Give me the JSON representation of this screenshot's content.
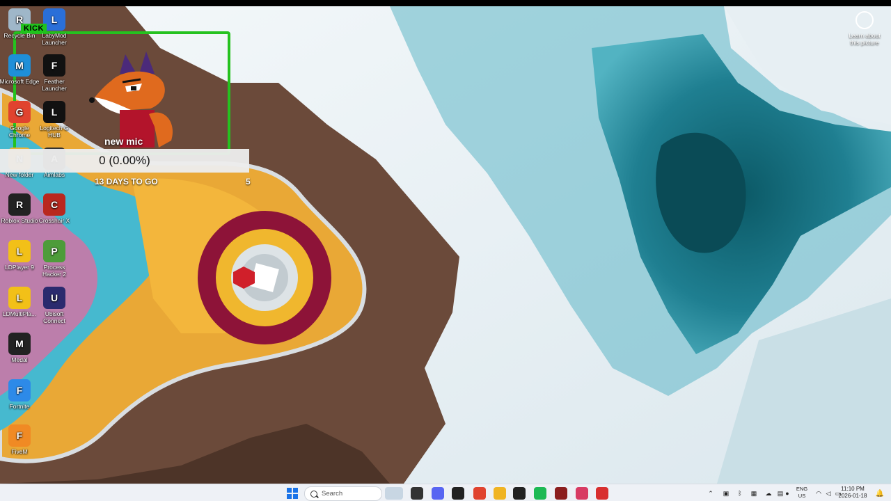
{
  "colors": {
    "ice": "#eaf2f5",
    "water": "#2b8ea0",
    "deep_water": "#0c5e6c",
    "rock": "#6b4a3a",
    "overlay_green": "#25c21f",
    "taskbar_bg": "#eef1f6"
  },
  "desktop_icons": [
    {
      "label": "Recycle Bin",
      "icon": "recycle-bin-icon",
      "color": "#9fb7c9"
    },
    {
      "label": "LabyMod Launcher",
      "icon": "labymod-icon",
      "color": "#2a6fd8"
    },
    {
      "label": "Microsoft Edge",
      "icon": "edge-icon",
      "color": "#1f8fd8"
    },
    {
      "label": "Feather Launcher",
      "icon": "feather-icon",
      "color": "#111111"
    },
    {
      "label": "Google Chrome",
      "icon": "chrome-icon",
      "color": "#e0432f"
    },
    {
      "label": "Logitech G HUB",
      "icon": "logitech-icon",
      "color": "#111111"
    },
    {
      "label": "New folder",
      "icon": "folder-icon",
      "color": "#e9b43a"
    },
    {
      "label": "Aimlabs",
      "icon": "aimlabs-icon",
      "color": "#333333"
    },
    {
      "label": "Roblox Studio",
      "icon": "roblox-icon",
      "color": "#222222"
    },
    {
      "label": "Crosshair X",
      "icon": "crosshair-icon",
      "color": "#b9281f"
    },
    {
      "label": "LDPlayer 9",
      "icon": "ldplayer-icon",
      "color": "#f2c018"
    },
    {
      "label": "Process Hacker 2",
      "icon": "process-hacker-icon",
      "color": "#4d9c3a"
    },
    {
      "label": "LDMultiPla...",
      "icon": "ldmultiplayer-icon",
      "color": "#f2c018"
    },
    {
      "label": "Ubisoft Connect",
      "icon": "ubisoft-icon",
      "color": "#2a2a6e"
    },
    {
      "label": "Medal",
      "icon": "medal-icon",
      "color": "#222222"
    },
    {
      "label": "Fortnite",
      "icon": "fortnite-icon",
      "color": "#2d8ae8"
    },
    {
      "label": "FiveM",
      "icon": "fivem-icon",
      "color": "#f08a24"
    }
  ],
  "overlay": {
    "badge": "KICK",
    "stream_title": "new mic",
    "goal_text": "0 (0.00%)",
    "countdown": "13 DAYS TO GO",
    "marker": "5"
  },
  "learn_about": {
    "label": "Learn about this picture",
    "icon": "camera-info-icon"
  },
  "taskbar": {
    "start_icon": "windows-start-icon",
    "search_placeholder": "Search",
    "pinned": [
      {
        "name": "widgets-icon",
        "color": "#c8d6e3"
      },
      {
        "name": "file-explorer-icon",
        "color": "#333333"
      },
      {
        "name": "discord-icon",
        "color": "#5865f2"
      },
      {
        "name": "epic-games-icon",
        "color": "#222222"
      },
      {
        "name": "chrome-icon",
        "color": "#e0432f"
      },
      {
        "name": "chrome-canary-icon",
        "color": "#f0b423"
      },
      {
        "name": "github-icon",
        "color": "#222222"
      },
      {
        "name": "spotify-icon",
        "color": "#1db954"
      },
      {
        "name": "medal-icon",
        "color": "#8b1e1e"
      },
      {
        "name": "snipping-tool-icon",
        "color": "#d83b63"
      },
      {
        "name": "record-icon",
        "color": "#d82f2f"
      }
    ],
    "tray_icons": [
      "chevron-up-icon",
      "nvidia-icon",
      "bluetooth-icon",
      "app-tray-icon",
      "onedrive-icon",
      "gpu-icon",
      "mic-icon"
    ],
    "lang_top": "ENG",
    "lang_bottom": "US",
    "status_icons": [
      "wifi-icon",
      "volume-icon",
      "battery-icon"
    ],
    "time": "11:10 PM",
    "date": "2026-01-18",
    "notification_icon": "notification-bell-icon"
  }
}
